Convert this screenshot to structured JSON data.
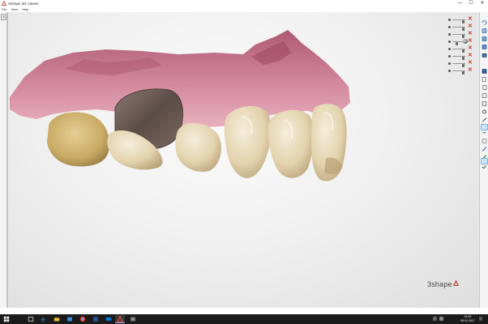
{
  "window": {
    "title": "3Shape 3D Viewer",
    "controls": [
      "—",
      "☐",
      "✕"
    ]
  },
  "menu": {
    "items": [
      "File",
      "View",
      "Help"
    ]
  },
  "left_panel": {
    "tab_glyph": "›"
  },
  "layers": {
    "delete_glyph": "✕",
    "rows": [
      {
        "name": "layer-1"
      },
      {
        "name": "layer-2"
      },
      {
        "name": "layer-3"
      },
      {
        "name": "layer-4"
      },
      {
        "name": "layer-5"
      },
      {
        "name": "layer-6"
      },
      {
        "name": "layer-7"
      },
      {
        "name": "layer-8"
      }
    ]
  },
  "toolbar": {
    "icons": [
      "rotate-icon",
      "view-front-icon",
      "view-top-icon",
      "view-side-icon",
      "layers-icon",
      "view-cube-icon",
      "copy-icon",
      "paste-icon",
      "measure-icon",
      "section-icon",
      "settings-icon",
      "eye-icon",
      "snapshot-icon",
      "transparency-icon",
      "annotate-icon",
      "screenshot-icon",
      "check-icon"
    ]
  },
  "logo": {
    "text": "3shape"
  },
  "taskbar": {
    "apps": [
      "start-icon",
      "task-view-icon",
      "edge-icon",
      "file-explorer-icon",
      "store-icon",
      "chrome-icon",
      "word-icon",
      "mail-icon",
      "3shape-viewer-icon",
      "photos-icon"
    ],
    "clock_time": "21:03",
    "clock_date": "08.01.2017"
  },
  "colors": {
    "gum": "#c9708a",
    "tooth": "#e8dcc0",
    "accent": "#0078d7",
    "delete": "#c0392b"
  }
}
